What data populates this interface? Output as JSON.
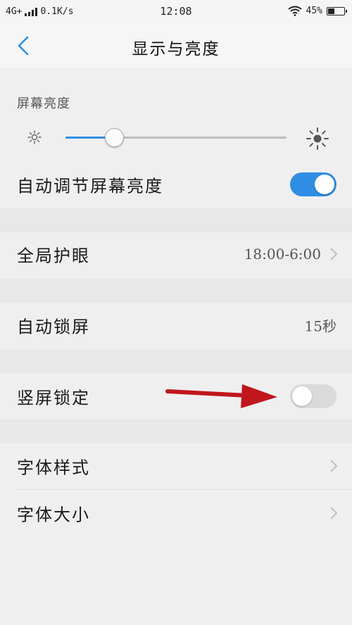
{
  "status_bar": {
    "network": "4G+",
    "speed": "0.1K/s",
    "time": "12:08",
    "battery": "45%",
    "battery_level": 0.45
  },
  "header": {
    "title": "显示与亮度",
    "back_icon": "chevron-left-icon"
  },
  "brightness": {
    "section_label": "屏幕亮度",
    "level": 0.22,
    "accent_color": "#2f8ee3"
  },
  "settings": {
    "auto_brightness": {
      "label": "自动调节屏幕亮度",
      "enabled": true
    },
    "eye_protection": {
      "label": "全局护眼",
      "value": "18:00-6:00"
    },
    "auto_lock": {
      "label": "自动锁屏",
      "value": "15秒"
    },
    "portrait_lock": {
      "label": "竖屏锁定",
      "enabled": false
    },
    "font_style": {
      "label": "字体样式"
    },
    "font_size": {
      "label": "字体大小"
    }
  },
  "annotation": {
    "arrow_color": "#c0161c"
  }
}
